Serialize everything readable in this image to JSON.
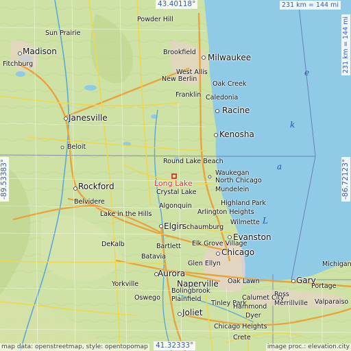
{
  "highlight": {
    "name": "Long Lake",
    "color": "#d2322d"
  },
  "coords": {
    "top_lat": "43.40118°",
    "bottom_lat": "41.32333°",
    "left_lon": "-89.53383°",
    "right_lon": "-86.72123°"
  },
  "scale": "231 km = 144 mi",
  "lake_letters": [
    "L",
    "a",
    "k",
    "e"
  ],
  "cities": [
    {
      "name": "Madison",
      "size": "big"
    },
    {
      "name": "Milwaukee",
      "size": "big"
    },
    {
      "name": "Racine",
      "size": "big"
    },
    {
      "name": "Kenosha",
      "size": "big"
    },
    {
      "name": "Janesville",
      "size": "big"
    },
    {
      "name": "Rockford",
      "size": "big"
    },
    {
      "name": "Evanston",
      "size": "big"
    },
    {
      "name": "Chicago",
      "size": "big"
    },
    {
      "name": "Elgin",
      "size": "big"
    },
    {
      "name": "Aurora",
      "size": "big"
    },
    {
      "name": "Naperville",
      "size": "big"
    },
    {
      "name": "Joliet",
      "size": "big"
    },
    {
      "name": "Gary",
      "size": "big"
    },
    {
      "name": "Sun Prairie",
      "size": "sm"
    },
    {
      "name": "Fitchburg",
      "size": "sm"
    },
    {
      "name": "Powder Hill",
      "size": "sm"
    },
    {
      "name": "Brookfield",
      "size": "sm"
    },
    {
      "name": "West Allis",
      "size": "sm"
    },
    {
      "name": "New Berlin",
      "size": "sm"
    },
    {
      "name": "Oak Creek",
      "size": "sm"
    },
    {
      "name": "Franklin",
      "size": "sm"
    },
    {
      "name": "Caledonia",
      "size": "sm"
    },
    {
      "name": "Beloit",
      "size": "sm"
    },
    {
      "name": "Round Lake Beach",
      "size": "sm"
    },
    {
      "name": "Waukegan",
      "size": "sm"
    },
    {
      "name": "North Chicago",
      "size": "sm"
    },
    {
      "name": "Mundelein",
      "size": "sm"
    },
    {
      "name": "Crystal Lake",
      "size": "sm"
    },
    {
      "name": "Belvidere",
      "size": "sm"
    },
    {
      "name": "Algonquin",
      "size": "sm"
    },
    {
      "name": "Highland Park",
      "size": "sm"
    },
    {
      "name": "Arlington Heights",
      "size": "sm"
    },
    {
      "name": "Lake in the Hills",
      "size": "sm"
    },
    {
      "name": "Wilmette",
      "size": "sm"
    },
    {
      "name": "Schaumburg",
      "size": "sm"
    },
    {
      "name": "DeKalb",
      "size": "sm"
    },
    {
      "name": "Bartlett",
      "size": "sm"
    },
    {
      "name": "Elk Grove Village",
      "size": "sm"
    },
    {
      "name": "Batavia",
      "size": "sm"
    },
    {
      "name": "Glen Ellyn",
      "size": "sm"
    },
    {
      "name": "Oak Lawn",
      "size": "sm"
    },
    {
      "name": "Oswego",
      "size": "sm"
    },
    {
      "name": "Bolingbrook",
      "size": "sm"
    },
    {
      "name": "Plainfield",
      "size": "sm"
    },
    {
      "name": "Tinley Park",
      "size": "sm"
    },
    {
      "name": "Calumet City",
      "size": "sm"
    },
    {
      "name": "Hammond",
      "size": "sm"
    },
    {
      "name": "Portage",
      "size": "sm"
    },
    {
      "name": "Merrillville",
      "size": "sm"
    },
    {
      "name": "Valparaiso",
      "size": "sm"
    },
    {
      "name": "Chicago Heights",
      "size": "sm"
    },
    {
      "name": "Michigan City",
      "size": "sm"
    },
    {
      "name": "Ross",
      "size": "sm"
    },
    {
      "name": "Dyer",
      "size": "sm"
    },
    {
      "name": "Crete",
      "size": "sm"
    },
    {
      "name": "Yorkville",
      "size": "sm"
    }
  ],
  "attribution": {
    "left": "map data: openstreetmap, style: opentopomap",
    "right": "image proc.: elevation.city"
  }
}
